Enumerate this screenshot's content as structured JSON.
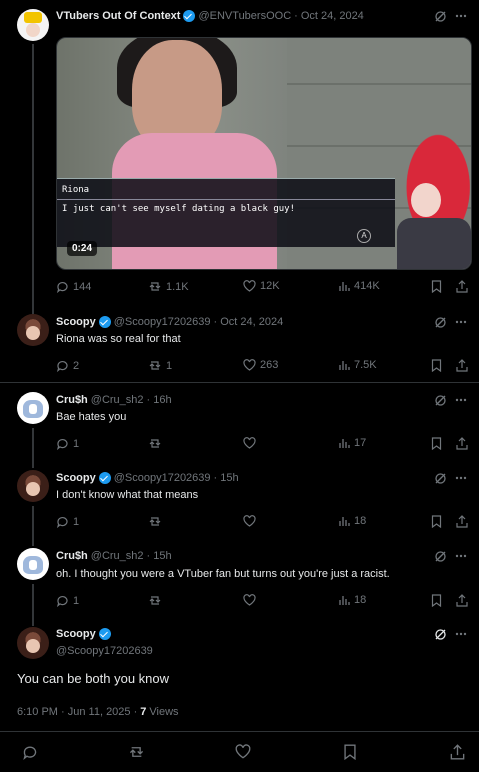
{
  "main_post": {
    "author": "VTubers Out Of Context",
    "handle": "@ENVTubersOOC",
    "date": "Oct 24, 2024",
    "video": {
      "speaker": "Riona",
      "line": "I just can't see myself dating a black guy!",
      "duration": "0:24",
      "button_glyph": "A"
    },
    "stats": {
      "replies": "144",
      "reposts": "1.1K",
      "likes": "12K",
      "views": "414K"
    }
  },
  "replies": [
    {
      "author": "Scoopy",
      "handle": "@Scoopy17202639",
      "date": "Oct 24, 2024",
      "text": "Riona was so real for that",
      "stats": {
        "replies": "2",
        "reposts": "1",
        "likes": "263",
        "views": "7.5K"
      }
    },
    {
      "author": "Cru$h",
      "handle": "@Cru_sh2",
      "date": "16h",
      "text": "Bae hates you",
      "stats": {
        "replies": "1",
        "reposts": "",
        "likes": "",
        "views": "17"
      }
    },
    {
      "author": "Scoopy",
      "handle": "@Scoopy17202639",
      "date": "15h",
      "text": "I don't know what that means",
      "stats": {
        "replies": "1",
        "reposts": "",
        "likes": "",
        "views": "18"
      }
    },
    {
      "author": "Cru$h",
      "handle": "@Cru_sh2",
      "date": "15h",
      "text": "oh. I thought you were a VTuber fan but turns out you're just a racist.",
      "stats": {
        "replies": "1",
        "reposts": "",
        "likes": "",
        "views": "18"
      }
    }
  ],
  "focused_post": {
    "author": "Scoopy",
    "handle": "@Scoopy17202639",
    "text": "You can be both you know",
    "meta_time": "6:10 PM · Jun 11, 2025 · ",
    "views_count": "7",
    "views_label": "Views"
  },
  "separator": "·",
  "colors": {
    "background": "#000000",
    "text": "#e7e9ea",
    "muted": "#71767b",
    "verified": "#1d9bf0",
    "divider": "#2f3336"
  }
}
